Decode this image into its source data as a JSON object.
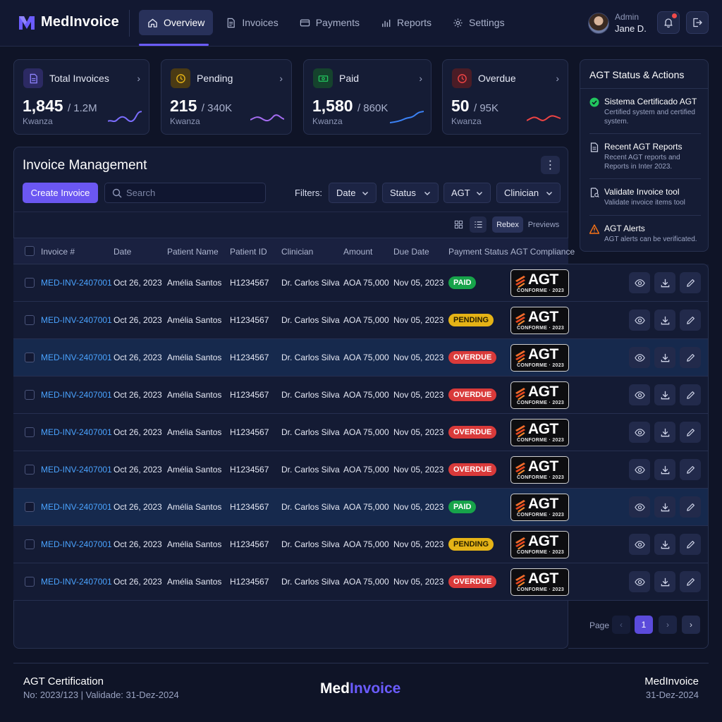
{
  "brand": {
    "name": "MedInvoice",
    "name_part1": "Med",
    "name_part2": "Invoice",
    "accent": "#6b5cff"
  },
  "nav": {
    "items": [
      {
        "label": "Overview",
        "icon": "home-icon",
        "active": true
      },
      {
        "label": "Invoices",
        "icon": "document-icon"
      },
      {
        "label": "Payments",
        "icon": "credit-card-icon"
      },
      {
        "label": "Reports",
        "icon": "bar-chart-icon"
      },
      {
        "label": "Settings",
        "icon": "gear-icon"
      }
    ]
  },
  "user": {
    "role": "Admin",
    "name": "Jane D."
  },
  "stats": [
    {
      "title": "Total Invoices",
      "value": "1,845",
      "secondary": "/ 1.2M",
      "sub": "Kwanza",
      "color": "#6b5cff"
    },
    {
      "title": "Pending",
      "value": "215",
      "secondary": "/ 340K",
      "sub": "Kwanza",
      "color": "#c38a12"
    },
    {
      "title": "Paid",
      "value": "1,580",
      "secondary": "/ 860K",
      "sub": "Kwanza",
      "color": "#17a34a"
    },
    {
      "title": "Overdue",
      "value": "50",
      "secondary": "/ 95K",
      "sub": "Kwanza",
      "color": "#d93a3a"
    }
  ],
  "agt_panel": {
    "title": "AGT Status & Actions",
    "items": [
      {
        "title": "Sistema Certificado AGT",
        "desc": "Certified system and certified system.",
        "icon": "check-circle-icon"
      },
      {
        "title": "Recent AGT Reports",
        "desc": "Recent AGT reports and Reports in Inter 2023.",
        "icon": "report-icon"
      },
      {
        "title": "Validate Invoice tool",
        "desc": "Validate invoice items tool",
        "icon": "validate-icon"
      },
      {
        "title": "AGT Alerts",
        "desc": "AGT alerts can be verificated.",
        "icon": "warning-icon"
      }
    ]
  },
  "main": {
    "title": "Invoice Management",
    "create_label": "Create Invoice",
    "search_placeholder": "Search",
    "filters_label": "Filters:",
    "filters": [
      "Date",
      "Status",
      "AGT",
      "Clinician"
    ],
    "tabs": [
      "Rebex",
      "Previews"
    ]
  },
  "table": {
    "columns": [
      "Invoice #",
      "Date",
      "Patient Name",
      "Patient ID",
      "Clinician",
      "Amount",
      "Due Date",
      "Payment Status",
      "AGT Compliance"
    ],
    "stamp": {
      "word": "AGT",
      "caption": "CONFORME · 2023"
    },
    "rows": [
      {
        "invoice": "MED-INV-2407001",
        "date": "Oct 26, 2023",
        "patient": "Amélia Santos",
        "pid": "H1234567",
        "clinician": "Dr. Carlos Silva",
        "amount": "AOA 75,000",
        "due": "Nov 05, 2023",
        "status": "PAID",
        "status_type": "paid",
        "highlight": false
      },
      {
        "invoice": "MED-INV-2407001",
        "date": "Oct 26, 2023",
        "patient": "Amélia Santos",
        "pid": "H1234567",
        "clinician": "Dr. Carlos Silva",
        "amount": "AOA 75,000",
        "due": "Nov 05, 2023",
        "status": "PENDING",
        "status_type": "pending",
        "highlight": false
      },
      {
        "invoice": "MED-INV-2407001",
        "date": "Oct 26, 2023",
        "patient": "Amélia Santos",
        "pid": "H1234567",
        "clinician": "Dr. Carlos Silva",
        "amount": "AOA 75,000",
        "due": "Nov 05, 2023",
        "status": "OVERDUE",
        "status_type": "overdue",
        "highlight": true
      },
      {
        "invoice": "MED-INV-2407001",
        "date": "Oct 26, 2023",
        "patient": "Amélia Santos",
        "pid": "H1234567",
        "clinician": "Dr. Carlos Silva",
        "amount": "AOA 75,000",
        "due": "Nov 05, 2023",
        "status": "OVERDUE",
        "status_type": "overdue",
        "highlight": false
      },
      {
        "invoice": "MED-INV-2407001",
        "date": "Oct 26, 2023",
        "patient": "Amélia Santos",
        "pid": "H1234567",
        "clinician": "Dr. Carlos Silva",
        "amount": "AOA 75,000",
        "due": "Nov 05, 2023",
        "status": "OVERDUE",
        "status_type": "overdue",
        "highlight": false
      },
      {
        "invoice": "MED-INV-2407001",
        "date": "Oct 26, 2023",
        "patient": "Amélia Santos",
        "pid": "H1234567",
        "clinician": "Dr. Carlos Silva",
        "amount": "AOA 75,000",
        "due": "Nov 05, 2023",
        "status": "OVERDUE",
        "status_type": "overdue",
        "highlight": false
      },
      {
        "invoice": "MED-INV-2407001",
        "date": "Oct 26, 2023",
        "patient": "Amélia Santos",
        "pid": "H1234567",
        "clinician": "Dr. Carlos Silva",
        "amount": "AOA 75,000",
        "due": "Nov 05, 2023",
        "status": "PAID",
        "status_type": "paid",
        "highlight": true
      },
      {
        "invoice": "MED-INV-2407001",
        "date": "Oct 26, 2023",
        "patient": "Amélia Santos",
        "pid": "H1234567",
        "clinician": "Dr. Carlos Silva",
        "amount": "AOA 75,000",
        "due": "Nov 05, 2023",
        "status": "PENDING",
        "status_type": "pending",
        "highlight": false
      },
      {
        "invoice": "MED-INV-2407001",
        "date": "Oct 26, 2023",
        "patient": "Amélia Santos",
        "pid": "H1234567",
        "clinician": "Dr. Carlos Silva",
        "amount": "AOA 75,000",
        "due": "Nov 05, 2023",
        "status": "OVERDUE",
        "status_type": "overdue",
        "highlight": false
      }
    ]
  },
  "pagination": {
    "label": "Page",
    "current": "1",
    "prev": "‹",
    "next": "›",
    "last": "›"
  },
  "footer": {
    "left_title": "AGT Certification",
    "left_sub": "No: 2023/123 | Validade: 31-Dez-2024",
    "right_title": "MedInvoice",
    "right_sub": "31-Dez-2024"
  }
}
